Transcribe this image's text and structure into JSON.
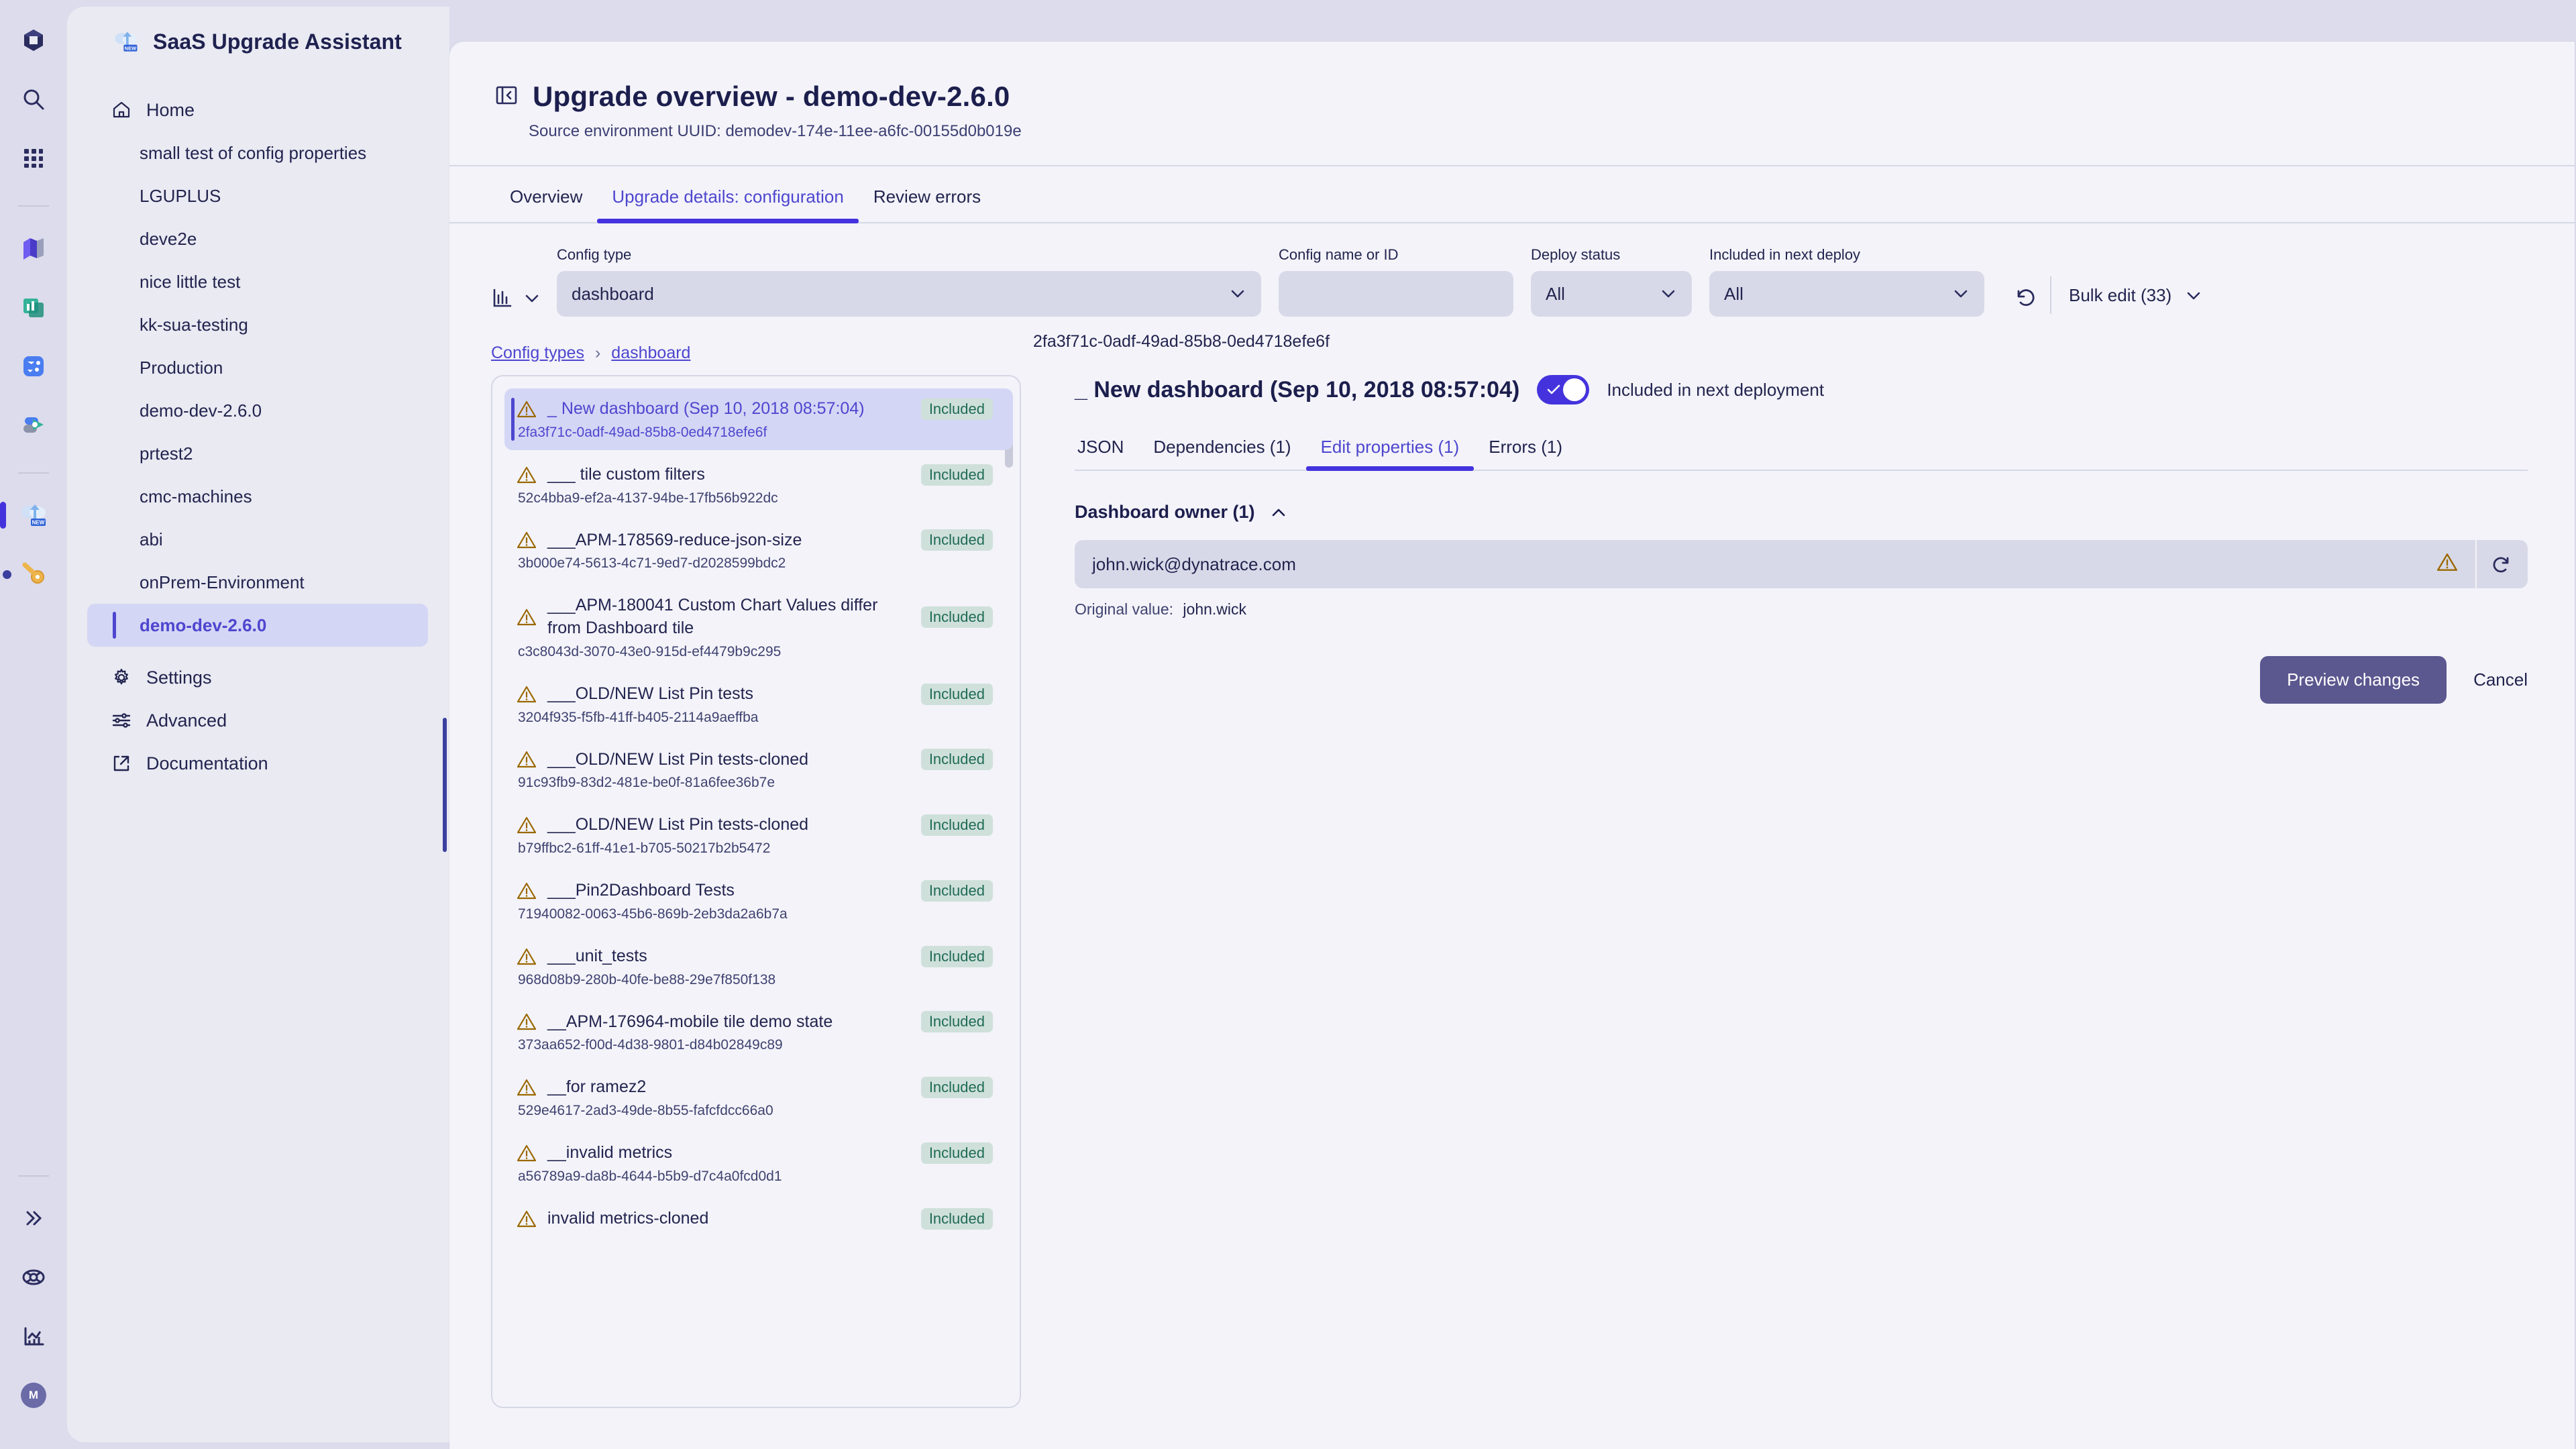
{
  "rail": {
    "icons": [
      {
        "name": "dynatrace-logo-icon"
      },
      {
        "name": "search-icon"
      },
      {
        "name": "apps-grid-icon"
      },
      {
        "name": "notebooks-icon"
      },
      {
        "name": "dashboards-icon"
      },
      {
        "name": "workflows-icon"
      },
      {
        "name": "data-explorer-icon"
      },
      {
        "name": "saas-upgrade-assistant-icon",
        "badge": "NEW",
        "active": true
      },
      {
        "name": "key-icon"
      }
    ],
    "bottom": [
      {
        "name": "expand-rail-icon",
        "glyph": "»"
      },
      {
        "name": "help-lifebuoy-icon"
      },
      {
        "name": "analytics-icon"
      },
      {
        "name": "user-avatar",
        "initial": "M"
      }
    ]
  },
  "sidebar": {
    "app_title": "SaaS Upgrade Assistant",
    "home_label": "Home",
    "environments": [
      "small test of config properties",
      "LGUPLUS",
      "deve2e",
      "nice little test",
      "kk-sua-testing",
      "Production",
      "demo-dev-2.6.0",
      "prtest2",
      "cmc-machines",
      "abi",
      "onPrem-Environment",
      "demo-dev-2.6.0"
    ],
    "active_environment_index": 11,
    "settings_label": "Settings",
    "advanced_label": "Advanced",
    "documentation_label": "Documentation"
  },
  "header": {
    "title": "Upgrade overview - demo-dev-2.6.0",
    "subtitle": "Source environment UUID: demodev-174e-11ee-a6fc-00155d0b019e",
    "collapse_icon": "collapse-panel-icon"
  },
  "tabs": [
    {
      "label": "Overview",
      "active": false
    },
    {
      "label": "Upgrade details: configuration",
      "active": true
    },
    {
      "label": "Review errors",
      "active": false
    }
  ],
  "filters": {
    "config_type": {
      "label": "Config type",
      "value": "dashboard"
    },
    "config_name": {
      "label": "Config name or ID",
      "value": "",
      "placeholder": ""
    },
    "deploy_status": {
      "label": "Deploy status",
      "value": "All"
    },
    "included_next_deploy": {
      "label": "Included in next deploy",
      "value": "All"
    },
    "reset_icon": "reset-filters-icon",
    "bulk_edit_label": "Bulk edit (33)"
  },
  "breadcrumb": {
    "root": "Config types",
    "separator": "›",
    "current": "dashboard"
  },
  "config_list": [
    {
      "name": "_ New dashboard (Sep 10, 2018 08:57:04)",
      "id": "2fa3f71c-0adf-49ad-85b8-0ed4718efe6f",
      "badge": "Included",
      "selected": true
    },
    {
      "name": "___ tile custom filters",
      "id": "52c4bba9-ef2a-4137-94be-17fb56b922dc",
      "badge": "Included",
      "selected": false
    },
    {
      "name": "___APM-178569-reduce-json-size",
      "id": "3b000e74-5613-4c71-9ed7-d2028599bdc2",
      "badge": "Included",
      "selected": false
    },
    {
      "name": "___APM-180041 Custom Chart Values differ from Dashboard tile",
      "id": "c3c8043d-3070-43e0-915d-ef4479b9c295",
      "badge": "Included",
      "selected": false
    },
    {
      "name": "___OLD/NEW List Pin tests",
      "id": "3204f935-f5fb-41ff-b405-2114a9aeffba",
      "badge": "Included",
      "selected": false
    },
    {
      "name": "___OLD/NEW List Pin tests-cloned",
      "id": "91c93fb9-83d2-481e-be0f-81a6fee36b7e",
      "badge": "Included",
      "selected": false
    },
    {
      "name": "___OLD/NEW List Pin tests-cloned",
      "id": "b79ffbc2-61ff-41e1-b705-50217b2b5472",
      "badge": "Included",
      "selected": false
    },
    {
      "name": "___Pin2Dashboard Tests",
      "id": "71940082-0063-45b6-869b-2eb3da2a6b7a",
      "badge": "Included",
      "selected": false
    },
    {
      "name": "___unit_tests",
      "id": "968d08b9-280b-40fe-be88-29e7f850f138",
      "badge": "Included",
      "selected": false
    },
    {
      "name": "__APM-176964-mobile tile demo state",
      "id": "373aa652-f00d-4d38-9801-d84b02849c89",
      "badge": "Included",
      "selected": false
    },
    {
      "name": "__for ramez2",
      "id": "529e4617-2ad3-49de-8b55-fafcfdcc66a0",
      "badge": "Included",
      "selected": false
    },
    {
      "name": "__invalid metrics",
      "id": "a56789a9-da8b-4644-b5b9-d7c4a0fcd0d1",
      "badge": "Included",
      "selected": false
    },
    {
      "name": "invalid metrics-cloned",
      "id": "",
      "badge": "Included",
      "selected": false
    }
  ],
  "detail": {
    "config_id": "2fa3f71c-0adf-49ad-85b8-0ed4718efe6f",
    "title": "_ New dashboard (Sep 10, 2018 08:57:04)",
    "toggle_label": "Included in next deployment",
    "toggle_on": true,
    "tabs": [
      {
        "label": "JSON",
        "active": false
      },
      {
        "label": "Dependencies (1)",
        "active": false
      },
      {
        "label": "Edit properties (1)",
        "active": true
      },
      {
        "label": "Errors (1)",
        "active": false
      }
    ],
    "section_title": "Dashboard owner (1)",
    "field_value": "john.wick@dynatrace.com",
    "field_warning_icon": "warning-triangle-icon",
    "field_reset_icon": "refresh-icon",
    "original_label": "Original value:",
    "original_value": "john.wick",
    "preview_label": "Preview changes",
    "cancel_label": "Cancel"
  },
  "colors": {
    "accent": "#4433dd",
    "accent_text": "#4e46cf",
    "warning": "#9a6800",
    "badge_text": "#1f6b55",
    "badge_bg": "#cfe0da",
    "primary_btn": "#5b578f"
  }
}
